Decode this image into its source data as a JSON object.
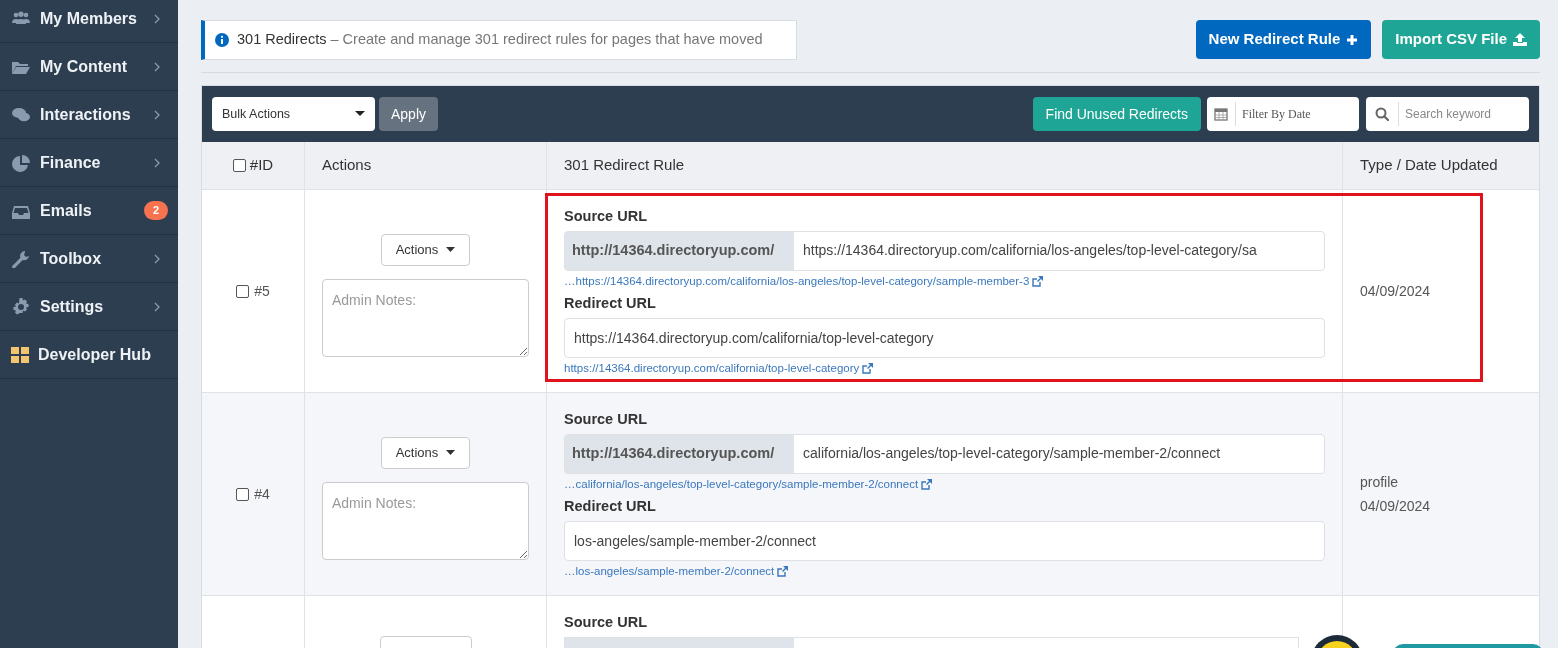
{
  "sidebar": {
    "items": [
      {
        "label": "My Members",
        "chevron": true
      },
      {
        "label": "My Content",
        "chevron": true
      },
      {
        "label": "Interactions",
        "chevron": true
      },
      {
        "label": "Finance",
        "chevron": true
      },
      {
        "label": "Emails",
        "chevron": false,
        "badge": "2"
      },
      {
        "label": "Toolbox",
        "chevron": true
      },
      {
        "label": "Settings",
        "chevron": true
      },
      {
        "label": "Developer Hub",
        "chevron": false
      }
    ]
  },
  "banner": {
    "title": "301 Redirects",
    "description": "– Create and manage 301 redirect rules for pages that have moved"
  },
  "header_buttons": [
    {
      "label": "New Redirect Rule",
      "kind": "new"
    },
    {
      "label": "Import CSV File",
      "kind": "import"
    }
  ],
  "toolbar": {
    "bulk_actions": "Bulk Actions",
    "apply": "Apply",
    "find_unused": "Find Unused Redirects",
    "date_filter": {
      "placeholder": "Filter By Date"
    },
    "search": {
      "placeholder": "Search keyword"
    }
  },
  "table": {
    "select_all": {
      "checked": false
    },
    "columns": [
      "#ID",
      "Actions",
      "301 Redirect Rule",
      "Type / Date Updated"
    ],
    "rows": [
      {
        "kind": "full",
        "id": "#5",
        "checked": false,
        "highlighted": true,
        "actions": "Actions",
        "notes": {
          "placeholder": "Admin Notes:"
        },
        "source_label": "Source URL",
        "source_prefix": "http://14364.directoryup.com/",
        "source_value": "https://14364.directoryup.com/california/los-angeles/top-level-category/sa",
        "source_link": "…https://14364.directoryup.com/california/los-angeles/top-level-category/sample-member-3",
        "redirect_label": "Redirect URL",
        "redirect_value": "https://14364.directoryup.com/california/top-level-category",
        "redirect_link": "https://14364.directoryup.com/california/top-level-category",
        "date": "04/09/2024"
      },
      {
        "kind": "full",
        "id": "#4",
        "checked": false,
        "highlighted": false,
        "actions": "Actions",
        "notes": {
          "placeholder": "Admin Notes:"
        },
        "source_label": "Source URL",
        "source_prefix": "http://14364.directoryup.com/",
        "source_value": "california/los-angeles/top-level-category/sample-member-2/connect",
        "source_link": "…california/los-angeles/top-level-category/sample-member-2/connect",
        "redirect_label": "Redirect URL",
        "redirect_value": "los-angeles/sample-member-2/connect",
        "redirect_link": "…los-angeles/sample-member-2/connect",
        "type": "profile",
        "date": "04/09/2024"
      },
      {
        "kind": "partial",
        "source_label": "Source URL"
      }
    ]
  }
}
